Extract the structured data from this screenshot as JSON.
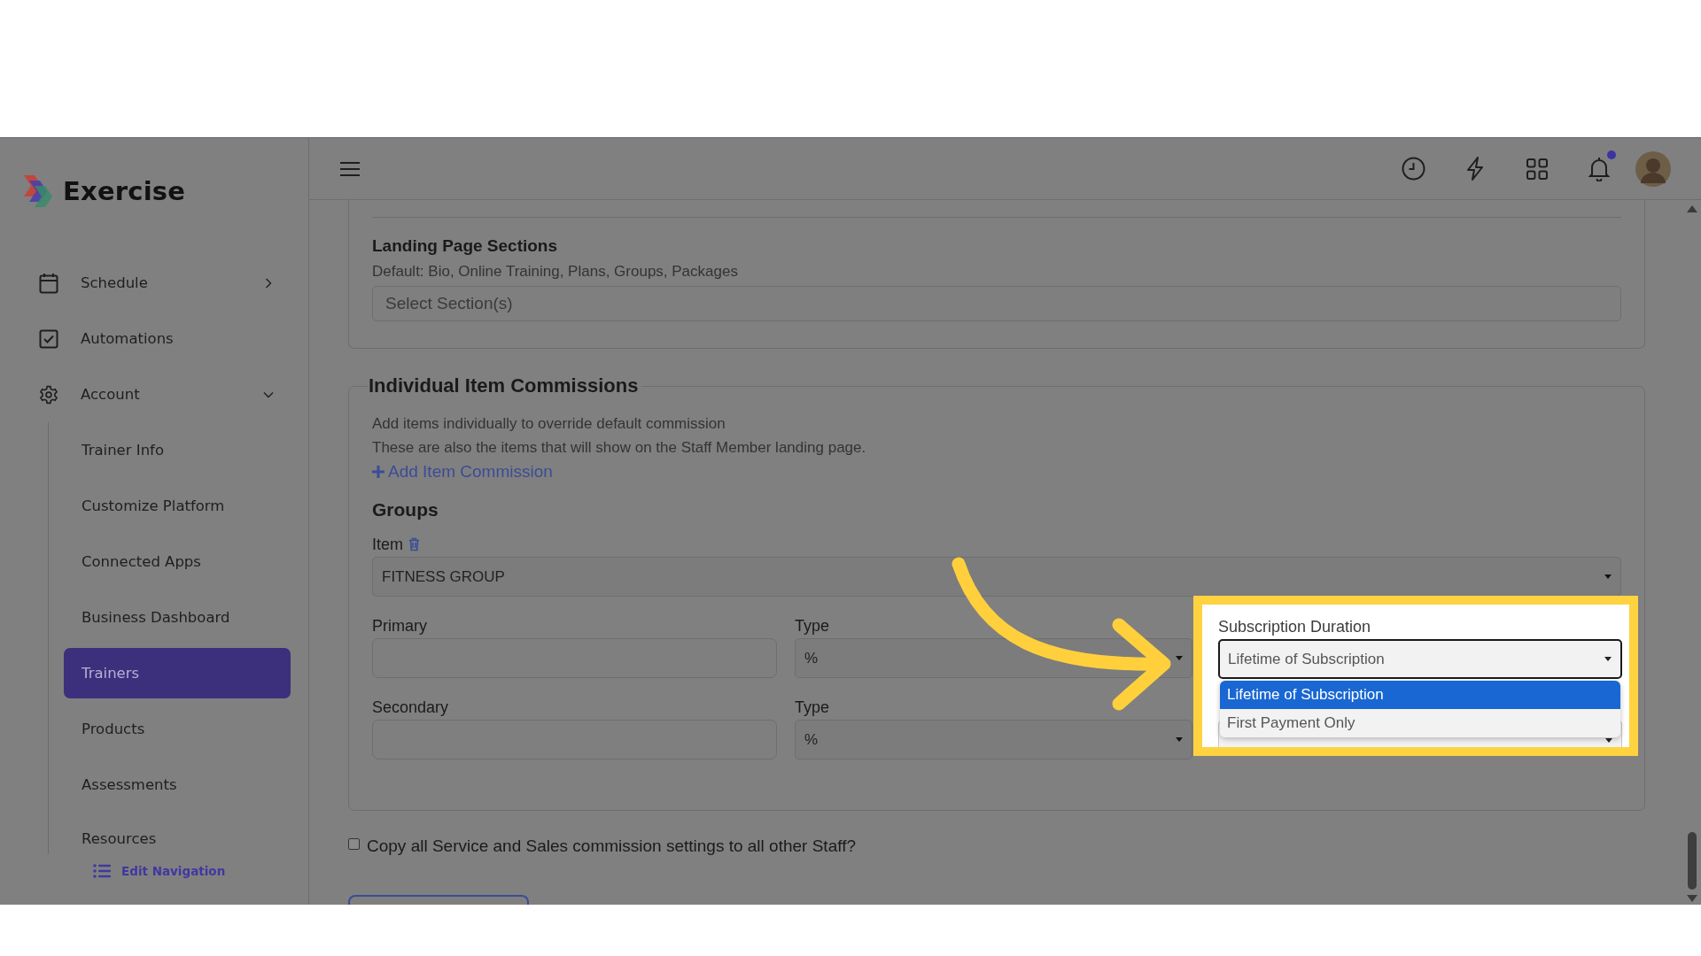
{
  "sidebar": {
    "brand": "Exercise",
    "items": [
      {
        "label": "Schedule",
        "expanded": false,
        "selected": false
      },
      {
        "label": "Automations",
        "selected": false
      },
      {
        "label": "Account",
        "expanded": true,
        "selected": false,
        "children": [
          {
            "label": "Trainer Info",
            "selected": false
          },
          {
            "label": "Customize Platform",
            "selected": false
          },
          {
            "label": "Connected Apps",
            "selected": false
          },
          {
            "label": "Business Dashboard",
            "selected": false
          },
          {
            "label": "Trainers",
            "selected": true
          },
          {
            "label": "Products",
            "selected": false
          },
          {
            "label": "Assessments",
            "selected": false
          },
          {
            "label": "Resources",
            "selected": false
          }
        ]
      }
    ],
    "edit_navigation": "Edit Navigation"
  },
  "header": {
    "notifications": {
      "unread": true
    }
  },
  "landing_sections": {
    "title": "Landing Page Sections",
    "hint": "Default: Bio, Online Training, Plans, Groups, Packages",
    "placeholder": "Select Section(s)"
  },
  "commissions": {
    "title": "Individual Item Commissions",
    "description": [
      "Add items individually to override default commission",
      "These are also the items that will show on the Staff Member landing page."
    ],
    "add_link": "Add Item Commission",
    "group_title": "Groups",
    "item_label": "Item",
    "item_value": "FITNESS GROUP",
    "rows": [
      {
        "amount_label": "Primary",
        "type_label": "Type",
        "type_value": "%"
      },
      {
        "amount_label": "Secondary",
        "type_label": "Type",
        "type_value": "%"
      }
    ]
  },
  "subscription_duration": {
    "label": "Subscription Duration",
    "value": "Lifetime of Subscription",
    "expanded": true,
    "options": [
      {
        "label": "Lifetime of Subscription",
        "selected": true
      },
      {
        "label": "First Payment Only",
        "selected": false
      }
    ]
  },
  "copy_settings": {
    "label": "Copy all Service and Sales commission settings to all other Staff?",
    "checked": false
  }
}
